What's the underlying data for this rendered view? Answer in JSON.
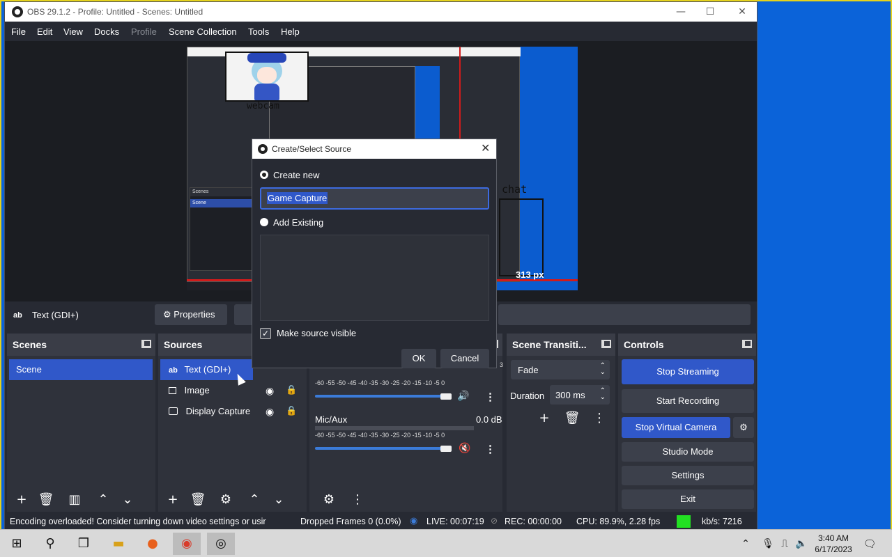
{
  "window": {
    "title": "OBS 29.1.2 - Profile: Untitled - Scenes: Untitled",
    "minimize": "—",
    "maximize": "☐",
    "close": "✕"
  },
  "menu": [
    "File",
    "Edit",
    "View",
    "Docks",
    "Profile",
    "Scene Collection",
    "Tools",
    "Help"
  ],
  "preview": {
    "webcam_label": "webcam",
    "chat_label": "chat",
    "px_label": "313 px",
    "scenes_mini": "Scenes",
    "scene_mini": "Scene"
  },
  "source_toolbar": {
    "icon": "ab",
    "name": "Text (GDI+)",
    "properties_label": "Properties"
  },
  "scenes": {
    "title": "Scenes",
    "items": [
      "Scene"
    ]
  },
  "sources": {
    "title": "Sources",
    "items": [
      {
        "label": "Text (GDI+)",
        "icon": "text-icon"
      },
      {
        "label": "Image",
        "icon": "image-icon"
      },
      {
        "label": "Display Capture",
        "icon": "monitor-icon"
      }
    ]
  },
  "audio_mixer": {
    "scale": "-60 -55 -50 -45 -40 -35 -30 -25 -20 -15 -10 -5 0",
    "desktop_scale_visible": "3",
    "mic_name": "Mic/Aux",
    "mic_db": "0.0 dB"
  },
  "transitions": {
    "title": "Scene Transiti...",
    "selected": "Fade",
    "duration_label": "Duration",
    "duration_value": "300 ms"
  },
  "controls": {
    "title": "Controls",
    "stop_streaming": "Stop Streaming",
    "start_recording": "Start Recording",
    "stop_virtual_camera": "Stop Virtual Camera",
    "studio_mode": "Studio Mode",
    "settings": "Settings",
    "exit": "Exit"
  },
  "status": {
    "message": "Encoding overloaded! Consider turning down video settings or usir",
    "dropped_frames": "Dropped Frames 0 (0.0%)",
    "live": "LIVE: 00:07:19",
    "rec": "REC: 00:00:00",
    "cpu": "CPU: 89.9%, 2.28 fps",
    "bitrate": "kb/s: 7216",
    "health_color": "#22e022"
  },
  "dialog": {
    "title": "Create/Select Source",
    "create_new_label": "Create new",
    "name_value": "Game Capture",
    "add_existing_label": "Add Existing",
    "make_visible_label": "Make source visible",
    "ok_label": "OK",
    "cancel_label": "Cancel"
  },
  "taskbar": {
    "time": "3:40 AM",
    "date": "6/17/2023"
  },
  "colors": {
    "accent": "#3058c9",
    "desktop": "#0b63d9",
    "panel": "#2f323b"
  }
}
